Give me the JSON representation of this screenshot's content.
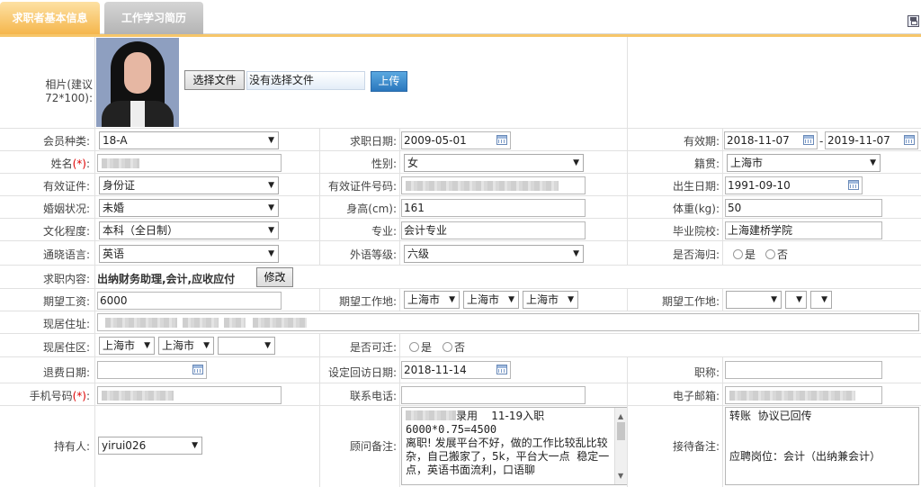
{
  "tabs": [
    {
      "label": "求职者基本信息"
    },
    {
      "label": "工作学习简历"
    }
  ],
  "photo": {
    "label": "相片(建议72*100):",
    "choose_button": "选择文件",
    "file_status": "没有选择文件",
    "upload_button": "上传"
  },
  "member_type": {
    "label": "会员种类:",
    "value": "18-A"
  },
  "apply_date": {
    "label": "求职日期:",
    "value": "2009-05-01"
  },
  "validity": {
    "label": "有效期:",
    "from": "2018-11-07",
    "sep": "-",
    "to": "2019-11-07"
  },
  "name": {
    "label": "姓名",
    "req": "(*)",
    "colon": ":"
  },
  "gender": {
    "label": "性别:",
    "value": "女"
  },
  "native_place": {
    "label": "籍贯:",
    "value": "上海市"
  },
  "id_type": {
    "label": "有效证件:",
    "value": "身份证"
  },
  "id_number": {
    "label": "有效证件号码:"
  },
  "birth_date": {
    "label": "出生日期:",
    "value": "1991-09-10"
  },
  "marital": {
    "label": "婚姻状况:",
    "value": "未婚"
  },
  "height": {
    "label": "身高(cm):",
    "value": "161"
  },
  "weight": {
    "label": "体重(kg):",
    "value": "50"
  },
  "education": {
    "label": "文化程度:",
    "value": "本科（全日制）"
  },
  "major": {
    "label": "专业:",
    "value": "会计专业"
  },
  "school": {
    "label": "毕业院校:",
    "value": "上海建桥学院"
  },
  "language": {
    "label": "通晓语言:",
    "value": "英语"
  },
  "language_level": {
    "label": "外语等级:",
    "value": "六级"
  },
  "overseas": {
    "label": "是否海归:",
    "yes": "是",
    "no": "否"
  },
  "job_content": {
    "label": "求职内容:",
    "value": "出纳财务助理,会计,应收应付",
    "edit_button": "修改"
  },
  "expected_salary": {
    "label": "期望工资:",
    "value": "6000"
  },
  "expected_location": {
    "label": "期望工作地:",
    "values": [
      "上海市",
      "上海市",
      "上海市"
    ]
  },
  "expected_location2": {
    "label": "期望工作地:"
  },
  "address": {
    "label": "现居住址:"
  },
  "residence": {
    "label": "现居住区:",
    "values": [
      "上海市",
      "上海市",
      ""
    ]
  },
  "relocate": {
    "label": "是否可迁:",
    "yes": "是",
    "no": "否"
  },
  "refund_date": {
    "label": "退费日期:"
  },
  "revisit_date": {
    "label": "设定回访日期:",
    "value": "2018-11-14"
  },
  "title": {
    "label": "职称:"
  },
  "mobile": {
    "label": "手机号码",
    "req": "(*)",
    "colon": ":"
  },
  "phone": {
    "label": "联系电话:"
  },
  "email": {
    "label": "电子邮箱:"
  },
  "holder": {
    "label": "持有人:",
    "value": "yirui026"
  },
  "consultant_note": {
    "label": "顾问备注:",
    "line1": "录用    11-19入职",
    "line2": "6000*0.75=4500",
    "line3": "离职! 发展平台不好，做的工作比较乱比较杂，自己搬家了，5k，平台大一点  稳定一点，英语书面流利，口语聊"
  },
  "reception_note": {
    "label": "接待备注:",
    "line1": "转账  协议已回传",
    "line2": "应聘岗位：会计（出纳兼会计）"
  },
  "icons": {
    "save": "save-icon",
    "calendar": "calendar-icon",
    "dropdown": "chevron-down-icon"
  },
  "colors": {
    "active_tab": "#f5b64c",
    "inactive_tab": "#b4b4b4",
    "upload_button": "#2a77bd",
    "required": "#dd0000"
  }
}
